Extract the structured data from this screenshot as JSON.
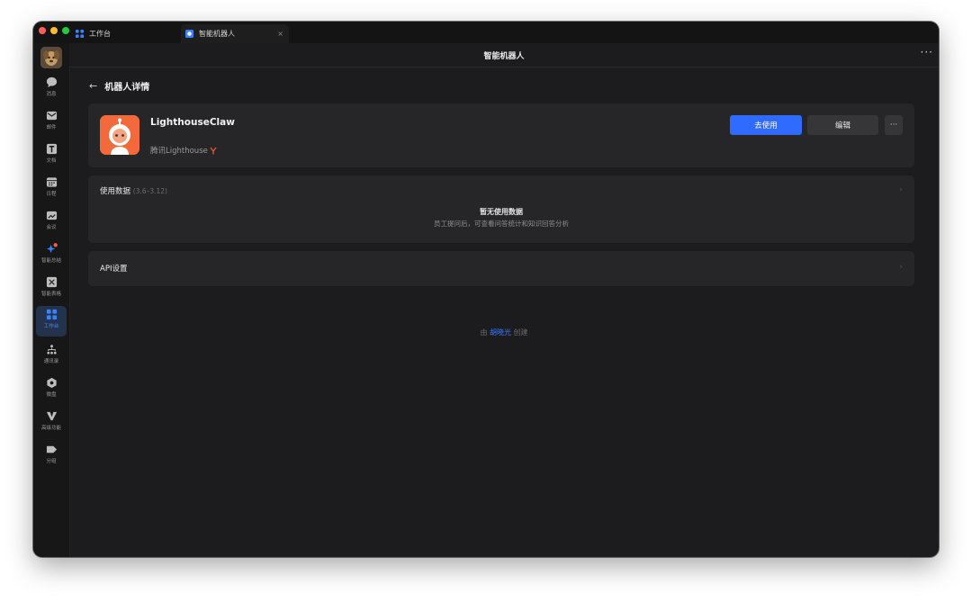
{
  "tabs": [
    {
      "label": "工作台"
    },
    {
      "label": "智能机器人",
      "close": "×"
    }
  ],
  "sidebar": {
    "items": [
      {
        "label": "消息",
        "icon": "chat-bubble-icon"
      },
      {
        "label": "邮件",
        "icon": "mail-icon"
      },
      {
        "label": "文档",
        "icon": "doc-icon"
      },
      {
        "label": "日程",
        "icon": "calendar-icon"
      },
      {
        "label": "会议",
        "icon": "meeting-icon"
      },
      {
        "label": "智能总结",
        "icon": "sparkle-icon"
      },
      {
        "label": "智能表格",
        "icon": "table-icon"
      },
      {
        "label": "工作台",
        "icon": "grid-icon",
        "active": true
      },
      {
        "label": "通讯录",
        "icon": "contacts-icon"
      },
      {
        "label": "微盘",
        "icon": "drive-icon"
      },
      {
        "label": "高级功能",
        "icon": "vip-icon"
      },
      {
        "label": "分组",
        "icon": "tag-icon"
      }
    ]
  },
  "header": {
    "title": "智能机器人",
    "more": "···"
  },
  "page": {
    "back": "←",
    "title": "机器人详情"
  },
  "bot": {
    "name": "LighthouseClaw",
    "org": "腾讯Lighthouse",
    "use_button": "去使用",
    "edit_button": "编辑",
    "more_button": "···"
  },
  "usage": {
    "title": "使用数据",
    "range": "(3.6–3.12)",
    "empty_title": "暂无使用数据",
    "empty_desc": "员工提问后，可查看问答统计和知识回答分析",
    "chevron": "›"
  },
  "api": {
    "title": "API设置",
    "chevron": "›"
  },
  "creator": {
    "prefix": "由",
    "name": "胡晓光",
    "suffix": "创建"
  },
  "colors": {
    "accent": "#2f6bff",
    "bot_logo": "#f26a3c",
    "window_bg": "#1c1c1e"
  }
}
